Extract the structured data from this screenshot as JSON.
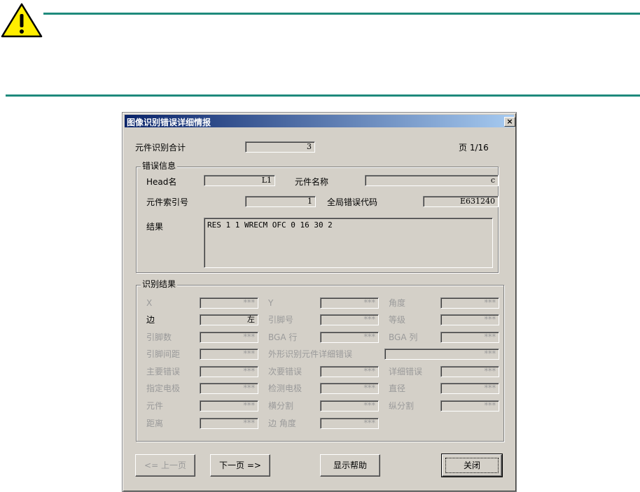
{
  "icon": "warning-icon",
  "accent_color": "#1e8a7c",
  "dialog": {
    "title": "图像识别错误详细情报",
    "close_label": "×",
    "summary": {
      "total_label": "元件识别合计",
      "total_value": "3",
      "page_label": "页 1/16"
    },
    "error_info": {
      "title": "错误信息",
      "head_label": "Head名",
      "head_value": "L1",
      "name_label": "元件名称",
      "name_value": "c",
      "index_label": "元件索引号",
      "index_value": "1",
      "global_code_label": "全局错误代码",
      "global_code_value": "E631240",
      "result_label": "结果",
      "result_value": "RES 1 1 WRECM OFC 0 16 30 2"
    },
    "recog": {
      "title": "识别结果",
      "x_label": "X",
      "x_value": "***",
      "y_label": "Y",
      "y_value": "***",
      "angle_label": "角度",
      "angle_value": "***",
      "side_label": "边",
      "side_value": "左",
      "pin_no_label": "引脚号",
      "pin_no_value": "***",
      "grade_label": "等级",
      "grade_value": "***",
      "pin_count_label": "引脚数",
      "pin_count_value": "***",
      "bga_row_label": "BGA 行",
      "bga_row_value": "***",
      "bga_col_label": "BGA 列",
      "bga_col_value": "***",
      "pin_pitch_label": "引脚间距",
      "pin_pitch_value": "***",
      "outline_err_label": "外形识别元件详细错误",
      "outline_err_value": "***",
      "major_err_label": "主要错误",
      "major_err_value": "***",
      "minor_err_label": "次要错误",
      "minor_err_value": "***",
      "detail_err_label": "详细错误",
      "detail_err_value": "***",
      "spec_elec_label": "指定电极",
      "spec_elec_value": "***",
      "detect_elec_label": "检测电极",
      "detect_elec_value": "***",
      "diameter_label": "直径",
      "diameter_value": "***",
      "component_label": "元件",
      "component_value": "***",
      "h_split_label": "横分割",
      "h_split_value": "***",
      "v_split_label": "纵分割",
      "v_split_value": "***",
      "distance_label": "距离",
      "distance_value": "***",
      "side_angle_label": "边 角度",
      "side_angle_value": "***"
    },
    "buttons": {
      "prev": "<= 上一页",
      "next": "下一页 =>",
      "help": "显示帮助",
      "close": "关闭"
    }
  }
}
